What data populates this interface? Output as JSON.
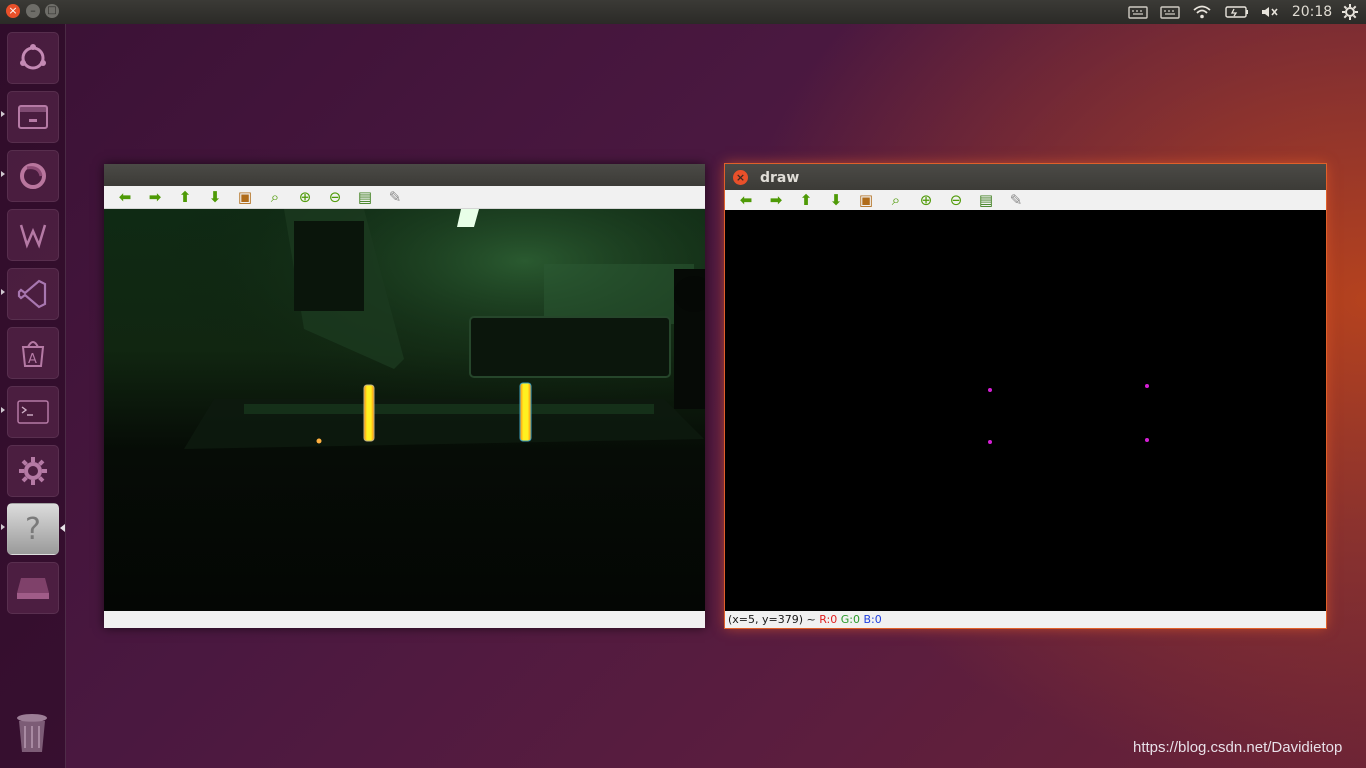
{
  "top_panel": {
    "clock": "20:18",
    "window_controls": [
      "close-icon",
      "minimize-icon",
      "maximize-icon"
    ],
    "tray_icons": [
      "keyboard-icon",
      "keyboard-icon",
      "wifi-icon",
      "battery-icon",
      "volume-muted-icon",
      "power-gear-icon"
    ]
  },
  "launcher": {
    "items": [
      {
        "icon": "ubuntu-dash-icon"
      },
      {
        "icon": "files-icon"
      },
      {
        "icon": "firefox-icon"
      },
      {
        "icon": "wps-writer-icon"
      },
      {
        "icon": "vscode-icon"
      },
      {
        "icon": "software-center-icon"
      },
      {
        "icon": "terminal-icon"
      },
      {
        "icon": "system-settings-icon"
      },
      {
        "icon": "unknown-app-icon",
        "glyph": "?",
        "active": true
      },
      {
        "icon": "drive-icon"
      },
      {
        "icon": "trash-icon"
      }
    ]
  },
  "windows": {
    "camera": {
      "title": "",
      "status_text": ""
    },
    "draw": {
      "title": "draw",
      "status": {
        "coords": "(x=5, y=379) ~",
        "r": "R:0",
        "g": "G:0",
        "b": "B:0"
      },
      "colors": {
        "r": "#e02020",
        "g": "#2a9a2a",
        "b": "#2040e0"
      }
    }
  },
  "toolbar": {
    "buttons": [
      {
        "name": "pan-left-button",
        "icon": "arrow-left-icon",
        "glyph": "⬅",
        "kind": "arrow"
      },
      {
        "name": "pan-right-button",
        "icon": "arrow-right-icon",
        "glyph": "➡",
        "kind": "arrow"
      },
      {
        "name": "pan-up-button",
        "icon": "arrow-up-icon",
        "glyph": "⬆",
        "kind": "arrow"
      },
      {
        "name": "pan-down-button",
        "icon": "arrow-down-icon",
        "glyph": "⬇",
        "kind": "arrow"
      },
      {
        "name": "zoom-original-button",
        "icon": "image-icon",
        "glyph": "▣",
        "kind": "img"
      },
      {
        "name": "zoom-fit-button",
        "icon": "zoom-fit-icon",
        "glyph": "⌕",
        "kind": "zoom"
      },
      {
        "name": "zoom-in-button",
        "icon": "zoom-in-icon",
        "glyph": "⊕",
        "kind": "zoom"
      },
      {
        "name": "zoom-out-button",
        "icon": "zoom-out-icon",
        "glyph": "⊖",
        "kind": "zoom"
      },
      {
        "name": "save-button",
        "icon": "save-icon",
        "glyph": "▤",
        "kind": "save"
      },
      {
        "name": "properties-button",
        "icon": "brush-icon",
        "glyph": "✎",
        "kind": "brush"
      }
    ]
  },
  "watermark": "https://blog.csdn.net/Davidietop"
}
